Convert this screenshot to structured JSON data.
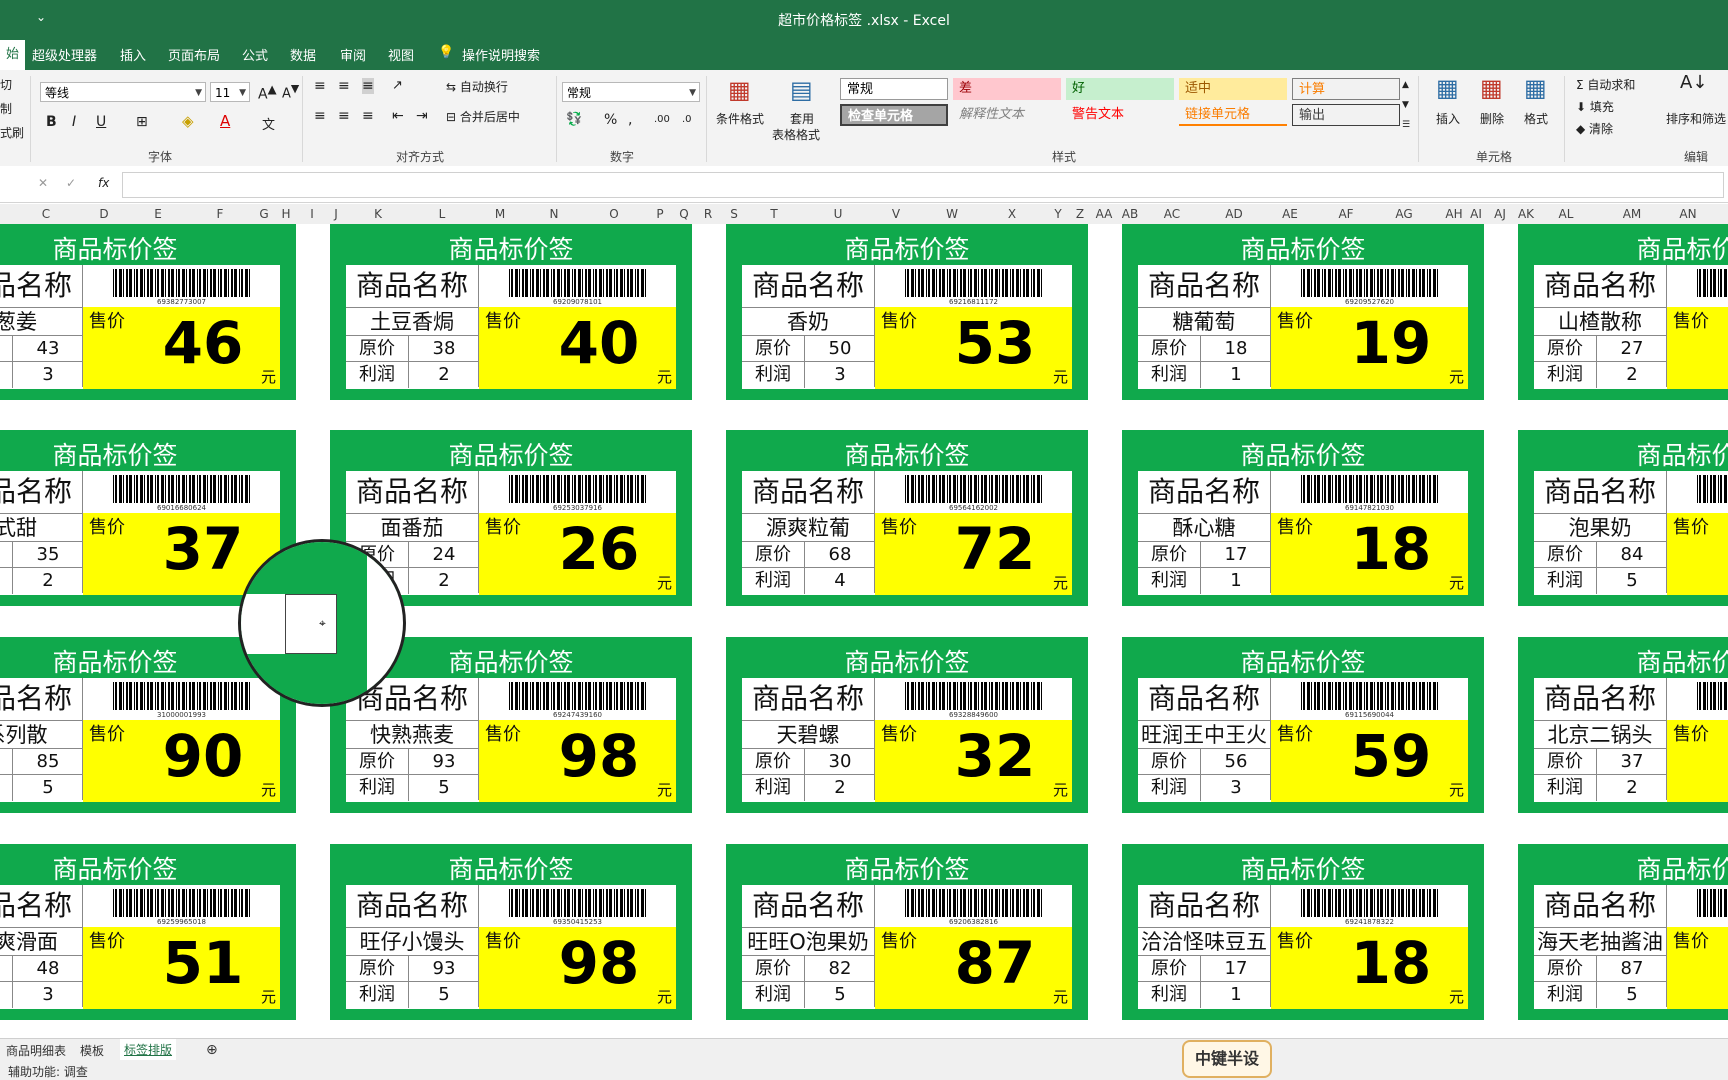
{
  "titlebar": {
    "qat": "⌄",
    "title": "超市价格标签 .xlsx  -  Excel"
  },
  "tabs": [
    "始",
    "超级处理器",
    "插入",
    "页面布局",
    "公式",
    "数据",
    "审阅",
    "视图",
    "操作说明搜索"
  ],
  "ribbon": {
    "clipboard": {
      "cut": "切",
      "copy": "制",
      "fmt": "式刷"
    },
    "font": {
      "name": "等线",
      "size": "11",
      "label": "字体"
    },
    "align": {
      "wrap": "自动换行",
      "merge": "合并后居中",
      "label": "对齐方式"
    },
    "number": {
      "format": "常规",
      "label": "数字"
    },
    "styles": {
      "cond": "条件格式",
      "table1": "套用",
      "table2": "表格格式",
      "cells": [
        "常规",
        "差",
        "好",
        "适中",
        "计算",
        "检查单元格",
        "解释性文本",
        "警告文本",
        "链接单元格",
        "输出"
      ],
      "label": "样式"
    },
    "cellgroup": {
      "insert": "插入",
      "delete": "删除",
      "format": "格式",
      "label": "单元格"
    },
    "editing": {
      "autosum": "自动求和",
      "fill": "填充",
      "clear": "清除",
      "sort": "排序和筛选",
      "label": "编辑"
    }
  },
  "formula_bar": {
    "fx": "fx"
  },
  "columns": [
    "C",
    "D",
    "E",
    "F",
    "G",
    "H",
    "I",
    "J",
    "K",
    "L",
    "M",
    "N",
    "O",
    "P",
    "Q",
    "R",
    "S",
    "T",
    "U",
    "V",
    "W",
    "X",
    "Y",
    "Z",
    "AA",
    "AB",
    "AC",
    "AD",
    "AE",
    "AF",
    "AG",
    "AH",
    "AI",
    "AJ",
    "AK",
    "AL",
    "AM",
    "AN"
  ],
  "label_common": {
    "header": "商品标价签",
    "name_title": "商品名称",
    "sale": "售价",
    "orig": "原价",
    "profit": "利润",
    "unit": "元"
  },
  "labels": [
    {
      "name": "葱姜",
      "orig": "43",
      "profit": "3",
      "price": "46",
      "barcode": "69382773007"
    },
    {
      "name": "土豆香焗",
      "orig": "38",
      "profit": "2",
      "price": "40",
      "barcode": "69209078101"
    },
    {
      "name": "香奶",
      "orig": "50",
      "profit": "3",
      "price": "53",
      "barcode": "69216811172"
    },
    {
      "name": "糖葡萄",
      "orig": "18",
      "profit": "1",
      "price": "19",
      "barcode": "69209527620"
    },
    {
      "name": "山楂散称",
      "orig": "27",
      "profit": "2",
      "price": "",
      "barcode": ""
    },
    {
      "name": "式甜",
      "orig": "35",
      "profit": "2",
      "price": "37",
      "barcode": "69016680624"
    },
    {
      "name": "面番茄",
      "orig": "24",
      "profit": "2",
      "price": "26",
      "barcode": "69253037916"
    },
    {
      "name": "源爽粒葡",
      "orig": "68",
      "profit": "4",
      "price": "72",
      "barcode": "69564162002"
    },
    {
      "name": "酥心糖",
      "orig": "17",
      "profit": "1",
      "price": "18",
      "barcode": "69147821030"
    },
    {
      "name": "泡果奶",
      "orig": "84",
      "profit": "5",
      "price": "",
      "barcode": ""
    },
    {
      "name": "系列散",
      "orig": "85",
      "profit": "5",
      "price": "90",
      "barcode": "31000001993"
    },
    {
      "name": "快熟燕麦",
      "orig": "93",
      "profit": "5",
      "price": "98",
      "barcode": "69247439160"
    },
    {
      "name": "天碧螺",
      "orig": "30",
      "profit": "2",
      "price": "32",
      "barcode": "69328849600"
    },
    {
      "name": "旺润王中王火",
      "orig": "56",
      "profit": "3",
      "price": "59",
      "barcode": "69115690044"
    },
    {
      "name": "北京二锅头",
      "orig": "37",
      "profit": "2",
      "price": "",
      "barcode": ""
    },
    {
      "name": "福爽滑面",
      "orig": "48",
      "profit": "3",
      "price": "51",
      "barcode": "69259965018"
    },
    {
      "name": "旺仔小馒头",
      "orig": "93",
      "profit": "5",
      "price": "98",
      "barcode": "69350415253"
    },
    {
      "name": "旺旺O泡果奶",
      "orig": "82",
      "profit": "5",
      "price": "87",
      "barcode": "69206382816"
    },
    {
      "name": "洽洽怪味豆五",
      "orig": "17",
      "profit": "1",
      "price": "18",
      "barcode": "69241878322"
    },
    {
      "name": "海天老抽酱油",
      "orig": "87",
      "profit": "5",
      "price": "",
      "barcode": ""
    }
  ],
  "sheet_tabs": [
    "商品明细表",
    "模板",
    "标签排版"
  ],
  "status": "辅助功能: 调查",
  "watermark": "中键半设"
}
